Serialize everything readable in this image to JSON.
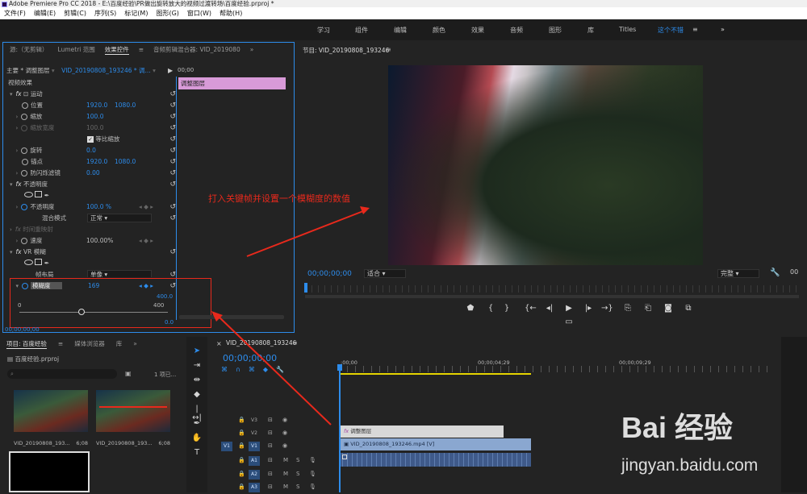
{
  "window": {
    "title": "Adobe Premiere Pro CC 2018 - E:\\百度经验\\PR做出旋转放大的视频过渡转场\\百度经验.prproj *"
  },
  "menu": [
    "文件(F)",
    "编辑(E)",
    "剪辑(C)",
    "序列(S)",
    "标记(M)",
    "图形(G)",
    "窗口(W)",
    "帮助(H)"
  ],
  "workspaces": [
    "学习",
    "组件",
    "编辑",
    "颜色",
    "效果",
    "音频",
    "图形",
    "库",
    "Titles",
    "这个不错"
  ],
  "active_workspace": "这个不错",
  "source_tabs": [
    "源:（无剪辑）",
    "Lumetri 范围",
    "效果控件",
    "音频剪辑混合器: VID_2019080"
  ],
  "effect_controls": {
    "master_label": "主要 * 调整图层",
    "clip_label": "VID_20190808_193246 * 调...",
    "timecode_top": "00;00",
    "video_effects": "视频效果",
    "clip_bar": "调整图层",
    "motion": "运动",
    "position_label": "位置",
    "position_x": "1920.0",
    "position_y": "1080.0",
    "scale_label": "缩放",
    "scale_value": "100.0",
    "scale_width_label": "缩放宽度",
    "scale_width_value": "100.0",
    "uniform_scale": "等比缩放",
    "rotation_label": "旋转",
    "rotation_value": "0.0",
    "anchor_label": "锚点",
    "anchor_x": "1920.0",
    "anchor_y": "1080.0",
    "flicker_label": "防闪烁滤镜",
    "flicker_value": "0.00",
    "opacity": "不透明度",
    "opacity_label": "不透明度",
    "opacity_value": "100.0 %",
    "blend_label": "混合模式",
    "blend_value": "正常",
    "time_remap": "时间重映射",
    "speed_label": "速度",
    "speed_value": "100.00%",
    "vr_blur": "VR 模糊",
    "frame_layout_label": "帧布局",
    "frame_layout_value": "单像",
    "blurriness_label": "模糊度",
    "blurriness_value": "169",
    "blur_max_top": "400.0",
    "slider_min": "0",
    "slider_max": "400",
    "bottom_value": "0.0",
    "timecode_bottom": "00;00;00;00",
    "blurriness_fraction": 0.42
  },
  "program": {
    "title": "节目: VID_20190808_193246",
    "timecode": "00;00;00;00",
    "fit": "适合",
    "quality": "完整",
    "annotation": "打入关键帧并设置一个模糊度的数值"
  },
  "project": {
    "tabs": [
      "项目: 百度经验",
      "媒体浏览器",
      "库"
    ],
    "file": "百度经验.prproj",
    "count": "1 项已...",
    "items": [
      {
        "name": "VID_20190808_193...",
        "duration": "6;08"
      },
      {
        "name": "VID_20190808_193...",
        "duration": "6;08"
      }
    ]
  },
  "timeline": {
    "tab": "VID_20190808_193246",
    "timecode": "00;00;00;00",
    "ruler": [
      ":00;00",
      "00;00;04;29",
      "00;00;09;29"
    ],
    "tracks": [
      {
        "name": "V3"
      },
      {
        "name": "V2"
      },
      {
        "name": "V1",
        "target": "V1"
      },
      {
        "name": "A1",
        "target": "A1"
      },
      {
        "name": "A2"
      },
      {
        "name": "A3"
      }
    ],
    "clip_adjust": "调整图层",
    "clip_video": "VID_20190808_193246.mp4 [V]"
  },
  "watermark": {
    "brand": "Bai 经验",
    "url": "jingyan.baidu.com"
  },
  "colors": {
    "accent": "#2d8ceb",
    "clip_pink": "#d89ad8",
    "adjust_clip": "#d8d8d8",
    "video_clip": "#8aa7d0",
    "audio_clip": "#3f5a8a",
    "annotation": "#e8291c",
    "panel_highlight": "#2d8ceb"
  }
}
